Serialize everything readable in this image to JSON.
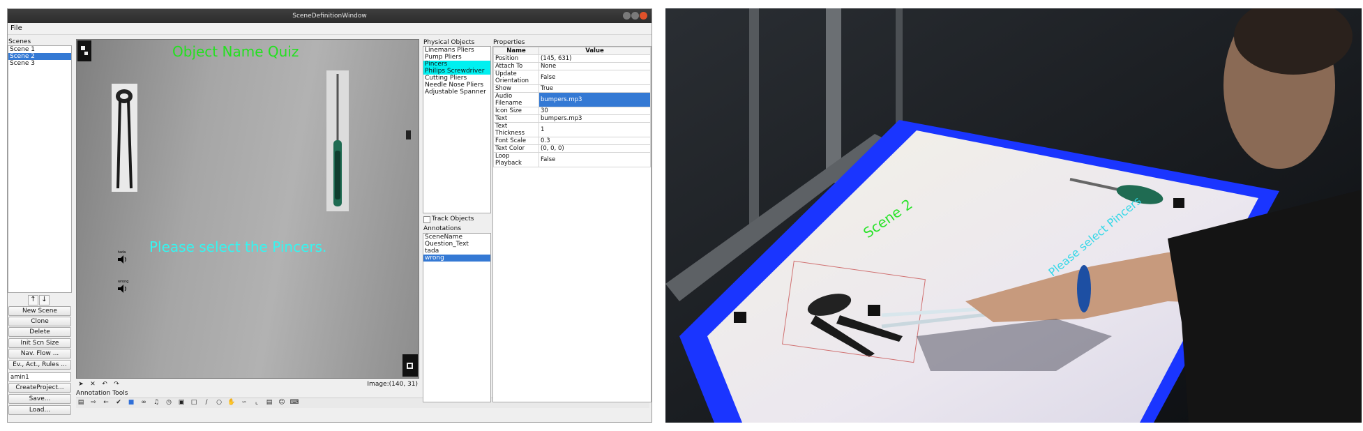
{
  "window": {
    "title": "SceneDefinitionWindow"
  },
  "menu": {
    "file": "File"
  },
  "scenes": {
    "header": "Scenes",
    "items": [
      "Scene 1",
      "Scene 2",
      "Scene 3"
    ],
    "selected_index": 1,
    "up_arrow": "↑",
    "down_arrow": "↓",
    "buttons": [
      "New Scene",
      "Clone",
      "Delete",
      "Init Scn Size",
      "Nav. Flow ...",
      "Ev., Act., Rules ..."
    ],
    "user_field": "amin1",
    "project_buttons": [
      "CreateProject...",
      "Save...",
      "Load..."
    ]
  },
  "canvas": {
    "quiz_title": "Object Name Quiz",
    "question": "Please select the Pincers.",
    "audio_label_1": "tada",
    "audio_label_2": "wrong",
    "image_coords": "Image:(140, 31)"
  },
  "physical_objects": {
    "header": "Physical Objects",
    "items": [
      "Linemans Pliers",
      "Pump Pliers",
      "Pincers",
      "Philips Screwdriver",
      "Cutting Pliers",
      "Needle Nose Pliers",
      "Adjustable Spanner"
    ],
    "highlighted": [
      2,
      3
    ],
    "track_objects_label": "Track Objects",
    "track_objects_checked": false
  },
  "annotations": {
    "header": "Annotations",
    "items": [
      "SceneName",
      "Question_Text",
      "tada",
      "wrong"
    ],
    "selected_index": 3
  },
  "properties": {
    "header": "Properties",
    "columns": [
      "Name",
      "Value"
    ],
    "rows": [
      {
        "name": "Position",
        "value": "(145, 631)"
      },
      {
        "name": "Attach To",
        "value": "None"
      },
      {
        "name": "Update Orientation",
        "value": "False"
      },
      {
        "name": "Show",
        "value": "True"
      },
      {
        "name": "Audio Filename",
        "value": "bumpers.mp3"
      },
      {
        "name": "Icon Size",
        "value": "30"
      },
      {
        "name": "Text",
        "value": "bumpers.mp3"
      },
      {
        "name": "Text Thickness",
        "value": "1"
      },
      {
        "name": "Font Scale",
        "value": "0.3"
      },
      {
        "name": "Text Color",
        "value": "(0, 0, 0)"
      },
      {
        "name": "Loop Playback",
        "value": "False"
      }
    ],
    "selected_row": 4
  },
  "annotation_tools": {
    "label": "Annotation Tools"
  },
  "photo": {
    "overlay_text_1": "Scene 2",
    "overlay_text_2": "Please select Pincers"
  },
  "colors": {
    "accent": "#3479d4",
    "highlight": "#00f0f0",
    "quiz_title": "#23e11f",
    "question": "#35f5f0",
    "table_glow": "#1a35ff"
  }
}
